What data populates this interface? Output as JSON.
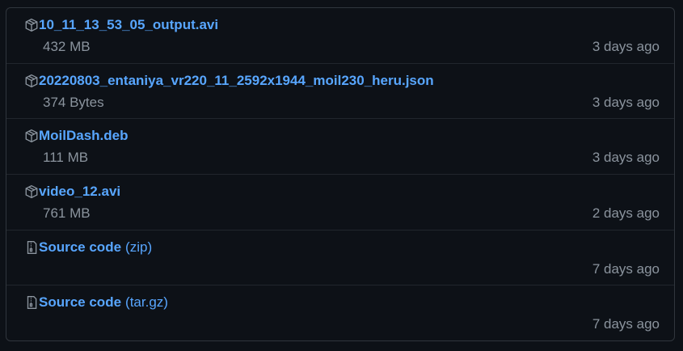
{
  "assets": [
    {
      "icon": "package-icon",
      "name": "10_11_13_53_05_output.avi",
      "suffix": "",
      "size": "432 MB",
      "date": "3 days ago"
    },
    {
      "icon": "package-icon",
      "name": "20220803_entaniya_vr220_11_2592x1944_moil230_heru.json",
      "suffix": "",
      "size": "374 Bytes",
      "date": "3 days ago"
    },
    {
      "icon": "package-icon",
      "name": "MoilDash.deb",
      "suffix": "",
      "size": "111 MB",
      "date": "3 days ago"
    },
    {
      "icon": "package-icon",
      "name": "video_12.avi",
      "suffix": "",
      "size": "761 MB",
      "date": "2 days ago"
    },
    {
      "icon": "file-zip-icon",
      "name": "Source code",
      "suffix": "(zip)",
      "size": "",
      "date": "7 days ago"
    },
    {
      "icon": "file-zip-icon",
      "name": "Source code",
      "suffix": "(tar.gz)",
      "size": "",
      "date": "7 days ago"
    }
  ],
  "colors": {
    "background": "#0d1117",
    "border": "#30363d",
    "link": "#58a6ff",
    "muted": "#8b949e"
  }
}
